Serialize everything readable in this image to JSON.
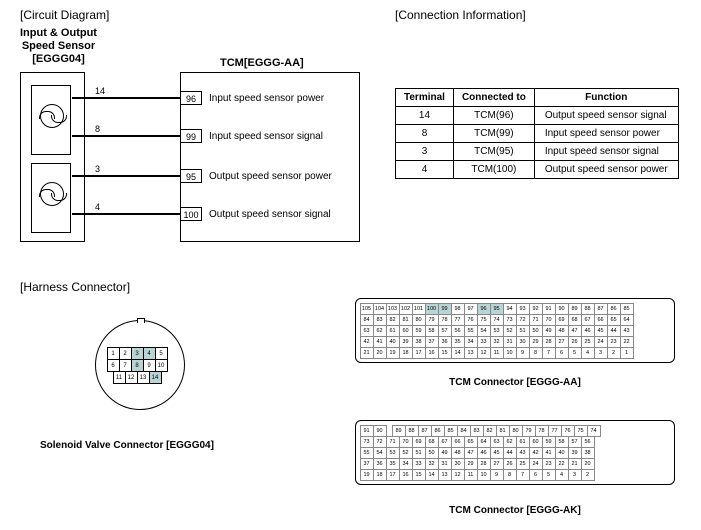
{
  "titles": {
    "circuit": "[Circuit Diagram]",
    "connection": "[Connection Information]",
    "harness": "[Harness Connector]"
  },
  "circuit": {
    "sensor_label_l1": "Input & Output",
    "sensor_label_l2": "Speed Sensor",
    "sensor_label_l3": "[EGGG04]",
    "tcm_label": "TCM[EGGG-AA]",
    "wires": [
      {
        "sensor_pin": "14",
        "tcm_pin": "96",
        "label": "Input speed sensor power"
      },
      {
        "sensor_pin": "8",
        "tcm_pin": "99",
        "label": "Input speed sensor signal"
      },
      {
        "sensor_pin": "3",
        "tcm_pin": "95",
        "label": "Output speed sensor power"
      },
      {
        "sensor_pin": "4",
        "tcm_pin": "100",
        "label": "Output speed sensor signal"
      }
    ]
  },
  "connection_table": {
    "headers": [
      "Terminal",
      "Connected to",
      "Function"
    ],
    "rows": [
      [
        "14",
        "TCM(96)",
        "Output speed sensor signal"
      ],
      [
        "8",
        "TCM(99)",
        "Input speed sensor power"
      ],
      [
        "3",
        "TCM(95)",
        "Input speed sensor signal"
      ],
      [
        "4",
        "TCM(100)",
        "Output speed sensor power"
      ]
    ]
  },
  "solenoid": {
    "label": "Solenoid Valve Connector [EGGG04]",
    "row1": [
      "1",
      "2",
      "3",
      "4",
      "5"
    ],
    "row2": [
      "6",
      "7",
      "8",
      "9",
      "10"
    ],
    "row3": [
      "11",
      "12",
      "13",
      "14"
    ],
    "highlighted": [
      "3",
      "4",
      "8",
      "14"
    ]
  },
  "tcm_aa": {
    "label": "TCM Connector [EGGG-AA]",
    "highlighted": [
      "95",
      "96",
      "99",
      "100"
    ]
  },
  "tcm_ak": {
    "label": "TCM Connector [EGGG-AK]"
  }
}
